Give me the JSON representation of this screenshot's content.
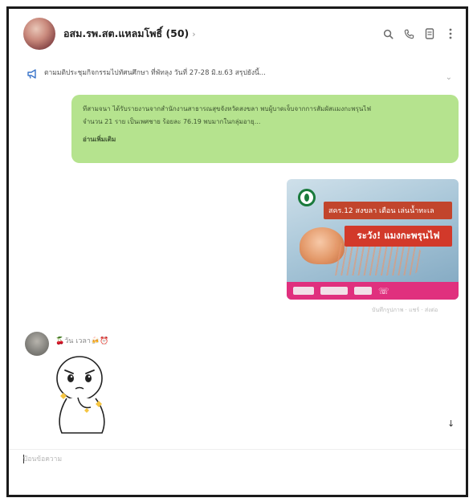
{
  "header": {
    "title": "อสม.รพ.สต.แหลมโพธิ์ (50)",
    "icons": [
      "search-icon",
      "phone-icon",
      "notes-icon",
      "more-vertical-icon"
    ]
  },
  "announcement": {
    "icon": "megaphone-icon",
    "text": "ตามมติประชุมกิจกรรมไปทัศนศึกษา ที่พัทลุง วันที่ 27-28 มิ.ย.63 สรุปยังนี้..."
  },
  "messages": {
    "green": {
      "line1": "ทีสามจนา ได้รับรายงานจากสำนักงานสาธารณสุขจังหวัดสงขลา พบผู้บาดเจ็บจากการสัมผัสแมงกะพรุนไฟ",
      "line2": "จำนวน 21 ราย เป็นเพศชาย ร้อยละ 76.19 พบมากในกลุ่มอายุ...",
      "more": "อ่านเพิ่มเติม"
    },
    "image": {
      "banner_line1": "สคร.12 สงขลา เตือน เล่นน้ำทะเล",
      "banner_line2": "ระวัง! แมงกะพรุนไฟ",
      "meta": "บันทึกรูปภาพ · แชร์ · ส่งต่อ"
    },
    "sender": {
      "name": "🍒วัน เวลา🍻⏰"
    }
  },
  "input": {
    "placeholder": "ป้อนข้อความ"
  },
  "colors": {
    "green_bubble": "#b5e38e",
    "poster_pink": "#e0307e",
    "poster_red": "#d2392a"
  }
}
